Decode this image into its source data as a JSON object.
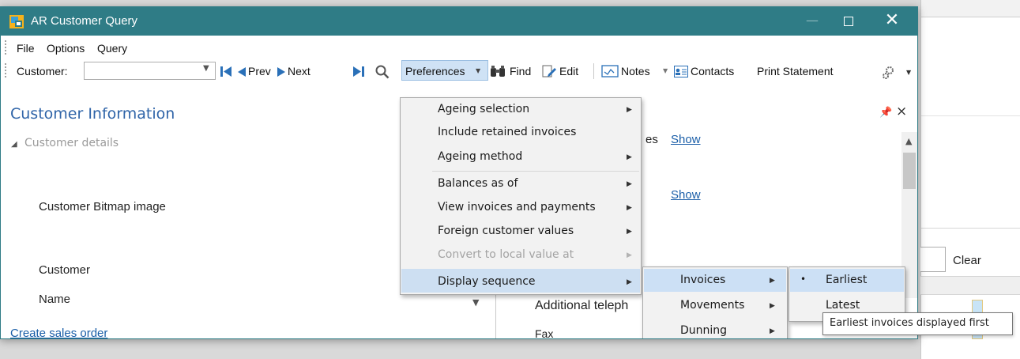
{
  "window": {
    "title": "AR Customer Query",
    "min_glyph": "—",
    "close_glyph": "✕"
  },
  "menubar": {
    "items": [
      "File",
      "Options",
      "Query"
    ]
  },
  "toolbar": {
    "customer_label": "Customer:",
    "customer_value": "",
    "prev": "Prev",
    "next": "Next",
    "preferences": "Preferences",
    "find": "Find",
    "edit": "Edit",
    "notes": "Notes",
    "contacts": "Contacts",
    "print_statement": "Print Statement"
  },
  "panel": {
    "title": "Customer Information",
    "section": "Customer details",
    "fields": {
      "bitmap": "Customer Bitmap image",
      "customer": "Customer",
      "name": "Name",
      "additional_telephone": "Additional teleph",
      "fax": "Fax",
      "partial_es": "es"
    },
    "show_links": [
      "Show",
      "Show"
    ],
    "create_sales_order": "Create sales order"
  },
  "preferences_menu": {
    "items": [
      {
        "label": "Ageing selection",
        "submenu": true,
        "disabled": false
      },
      {
        "label": "Include retained invoices",
        "submenu": false,
        "disabled": false
      },
      {
        "label": "Ageing method",
        "submenu": true,
        "disabled": false
      },
      {
        "label": "Balances as of",
        "submenu": true,
        "disabled": false
      },
      {
        "label": "View invoices and payments",
        "submenu": true,
        "disabled": false
      },
      {
        "label": "Foreign customer values",
        "submenu": true,
        "disabled": false
      },
      {
        "label": "Convert to local value at",
        "submenu": true,
        "disabled": true
      },
      {
        "label": "Display sequence",
        "submenu": true,
        "disabled": false
      }
    ],
    "highlighted": "Display sequence"
  },
  "display_sequence_menu": {
    "items": [
      {
        "label": "Invoices",
        "submenu": true
      },
      {
        "label": "Movements",
        "submenu": true
      },
      {
        "label": "Dunning",
        "submenu": true
      }
    ],
    "highlighted": "Invoices"
  },
  "invoices_menu": {
    "items": [
      {
        "label": "Earliest",
        "selected": true
      },
      {
        "label": "Latest",
        "selected": false
      }
    ],
    "highlighted": "Earliest"
  },
  "tooltip": {
    "text": "Earliest invoices displayed first"
  },
  "background_window": {
    "clear_label": "Clear"
  },
  "colors": {
    "titlebar": "#2f7c86",
    "accent_blue": "#2f64a8",
    "menu_highlight": "#cce0f5"
  }
}
